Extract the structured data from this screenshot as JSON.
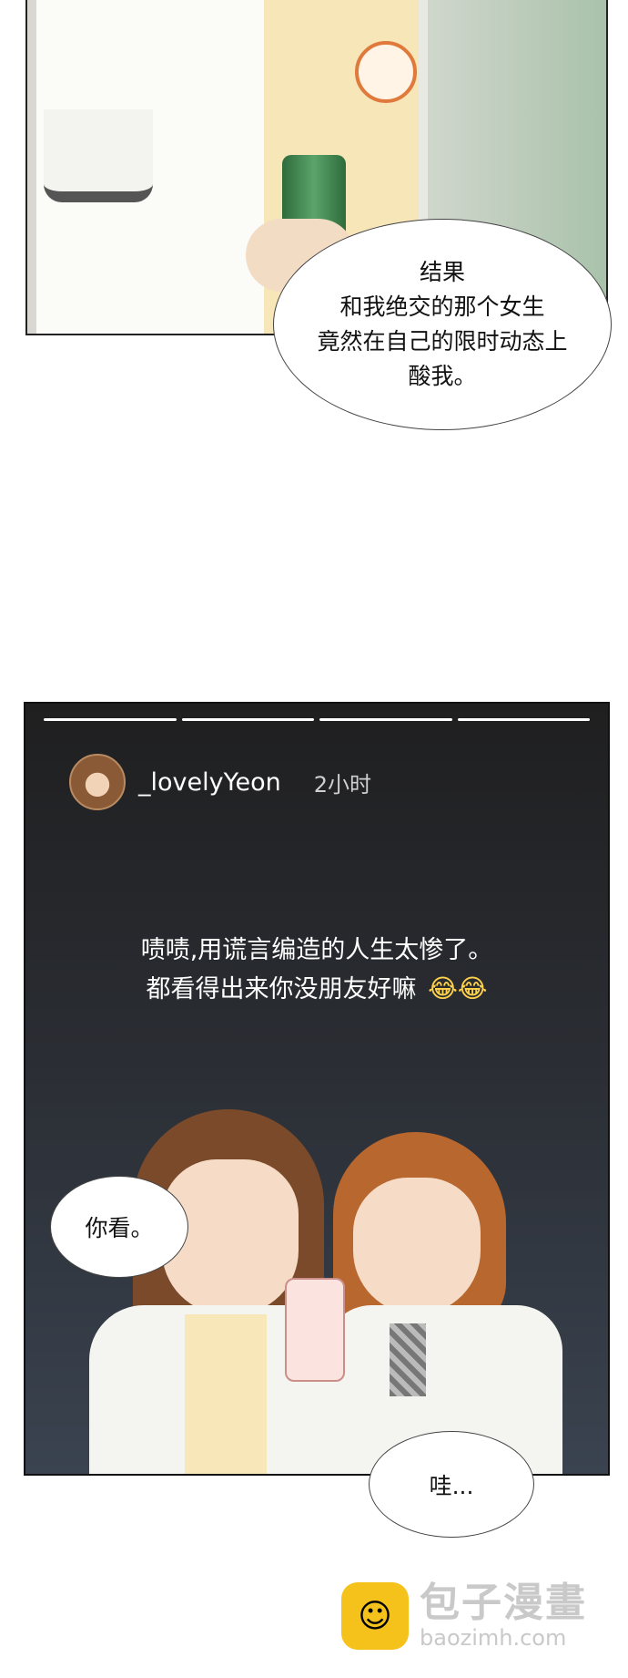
{
  "top_panel": {
    "bubble_lines": [
      "结果",
      "和我绝交的那个女生",
      "竟然在自己的限时动态上",
      "酸我。"
    ]
  },
  "story": {
    "progress_segments": 4,
    "username": "_lovelyYeon",
    "time": "2小时",
    "caption_line1": "啧啧,用谎言编造的人生太惨了。",
    "caption_line2": "都看得出来你没朋友好嘛",
    "caption_emoji": "😂😂"
  },
  "bubbles": {
    "look": "你看。",
    "wow": "哇..."
  },
  "watermark": {
    "name": "包子漫畫",
    "url": "baozimh.com",
    "icon": "bun-face-icon"
  },
  "colors": {
    "story_bg": "#1f1f20",
    "logo_yellow": "#f5c21b"
  }
}
